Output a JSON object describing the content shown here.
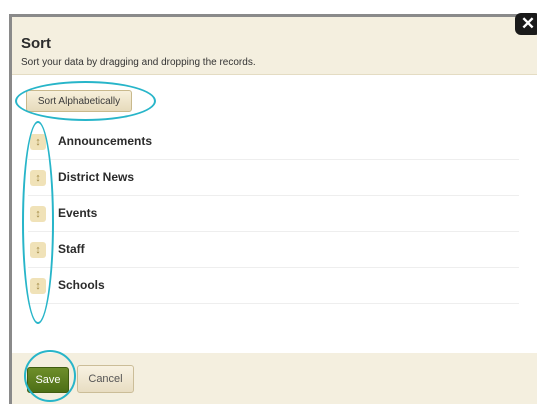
{
  "dialog": {
    "title": "Sort",
    "subtitle": "Sort your data by dragging and dropping the records.",
    "close_label": "✕",
    "sort_alphabetically_label": "Sort Alphabetically",
    "items": [
      {
        "label": "Announcements"
      },
      {
        "label": "District News"
      },
      {
        "label": "Events"
      },
      {
        "label": "Staff"
      },
      {
        "label": "Schools"
      }
    ],
    "save_label": "Save",
    "cancel_label": "Cancel"
  },
  "icons": {
    "drag_handle": "drag-handle-icon",
    "close": "close-icon"
  },
  "colors": {
    "header_bg": "#f4efdf",
    "save_button": "#5a7c1f",
    "annotation": "#27b5c9"
  }
}
